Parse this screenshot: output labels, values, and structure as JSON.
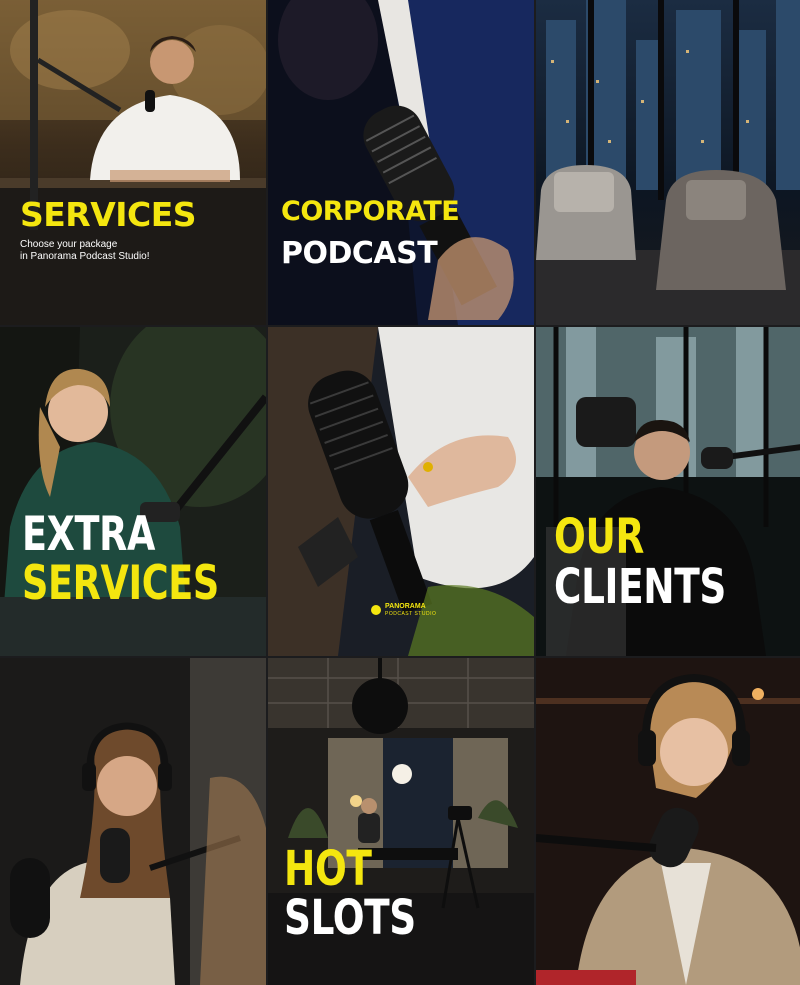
{
  "tiles": [
    {
      "line1": "SERVICES",
      "subtitle1": "Choose your package",
      "subtitle2": "in Panorama Podcast Studio!"
    },
    {
      "line1": "CORPORATE",
      "line2": "PODCAST"
    },
    {},
    {
      "line1": "EXTRA",
      "line2": "SERVICES"
    },
    {
      "brand": "PANORAMA",
      "brand_sub": "PODCAST STUDIO"
    },
    {
      "line1": "OUR",
      "line2": "CLIENTS"
    },
    {},
    {
      "line1": "HOT",
      "line2": "SLOTS"
    },
    {}
  ],
  "colors": {
    "accent": "#f4e60f",
    "text": "#ffffff"
  }
}
